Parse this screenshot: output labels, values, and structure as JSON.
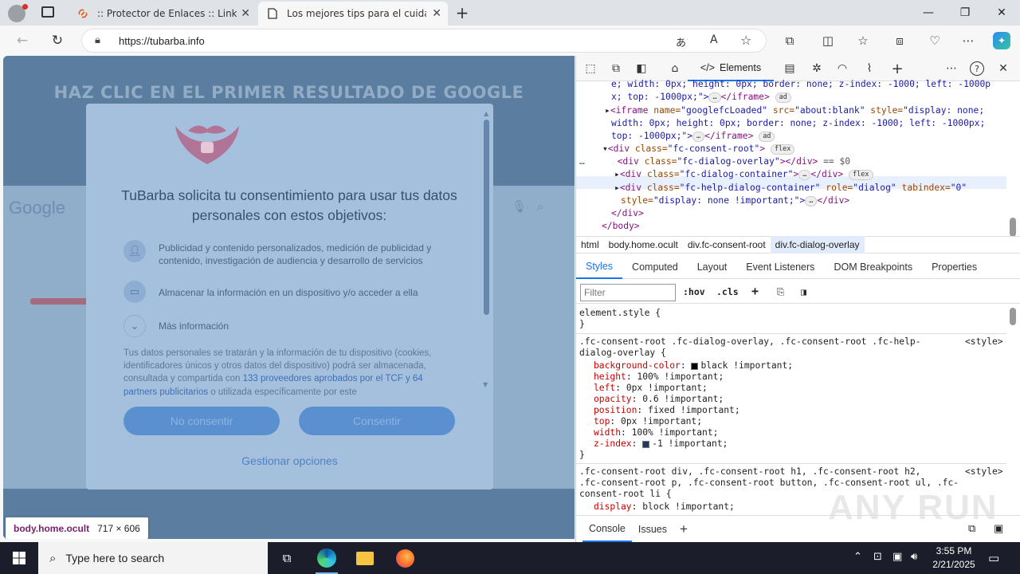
{
  "browser": {
    "tabs": [
      {
        "title": ":: Protector de Enlaces :: Link Prot",
        "active": false
      },
      {
        "title": "Los mejores tips para el cuidado",
        "active": true
      }
    ],
    "url": "https://tubarba.info"
  },
  "page": {
    "background_heading": "HAZ CLIC EN EL PRIMER RESULTADO DE GOOGLE",
    "google_logo": "Google",
    "consent": {
      "title": "TuBarba solicita tu consentimiento para usar tus datos personales con estos objetivos:",
      "purposes": [
        {
          "icon": "person-icon",
          "text": "Publicidad y contenido personalizados, medición de publicidad y contenido, investigación de audiencia y desarrollo de servicios"
        },
        {
          "icon": "device-icon",
          "text": "Almacenar la información en un dispositivo y/o acceder a ella"
        },
        {
          "icon": "chevron-down-icon",
          "text": "Más información"
        }
      ],
      "info_text_1": "Tus datos personales se tratarán y la información de tu dispositivo (cookies, identificadores únicos y otros datos del dispositivo) podrá ser almacenada, consultada y compartida con ",
      "info_link_1": "133 proveedores aprobados por el TCF y 64 partners publicitarios",
      "info_text_2": " o utilizada específicamente por este",
      "decline_label": "No consentir",
      "accept_label": "Consentir",
      "manage_label": "Gestionar opciones"
    },
    "inspect_tooltip": {
      "selector": "body.home.ocult",
      "size": "717 × 606"
    }
  },
  "devtools": {
    "active_tab": "Elements",
    "breadcrumb": [
      "html",
      "body.home.ocult",
      "div.fc-consent-root",
      "div.fc-dialog-overlay"
    ],
    "style_tabs": [
      "Styles",
      "Computed",
      "Layout",
      "Event Listeners",
      "DOM Breakpoints",
      "Properties"
    ],
    "filter_placeholder": "Filter",
    "filter_tools": [
      ":hov",
      ".cls"
    ],
    "console_tabs": [
      "Console",
      "Issues"
    ],
    "dom_lines": {
      "l1": "e; width: 0px; height: 0px; border: none; z-index: -1000; left: -1000p",
      "l2a": "x; top: -1000px;\">",
      "l2b": "</iframe>",
      "l3_tag": "<iframe",
      "l3_name": " name=",
      "l3_nv": "\"googlefcLoaded\"",
      "l3_src": " src=",
      "l3_sv": "\"about:blank\"",
      "l3_style": " style=",
      "l3_stv": "\"display: none;",
      "l4": "width: 0px; height: 0px; border: none; z-index: -1000; left: -1000px;",
      "l5a": "top: -1000px;\">",
      "l5b": "</iframe>",
      "l6a": "<div",
      "l6b": " class=",
      "l6c": "\"fc-consent-root\"",
      "l6d": ">",
      "l7a": "<div",
      "l7b": " class=",
      "l7c": "\"fc-dialog-overlay\"",
      "l7d": "></div>",
      "l7e": " == $0",
      "l8a": "<div",
      "l8b": " class=",
      "l8c": "\"fc-dialog-container\"",
      "l8d": ">",
      "l8e": "</div>",
      "l9a": "<div",
      "l9b": " class=",
      "l9c": "\"fc-help-dialog-container\"",
      "l9d": " role=",
      "l9e": "\"dialog\"",
      "l9f": " tabindex=",
      "l9g": "\"0\"",
      "l10a": "style=",
      "l10b": "\"display: none !important;\">",
      "l10c": "</div>",
      "l11": "</div>",
      "l12": "</body>",
      "pill_ad": "ad",
      "pill_flex": "flex",
      "ellipsis": "…"
    },
    "styles": {
      "element_style": "element.style {",
      "close": "}",
      "rule1_selector_a": ".fc-consent-root .fc-dialog-overlay, .fc-consent-root .fc-help-",
      "rule1_selector_b": "dialog-overlay {",
      "source": "<style>",
      "rule1_props": [
        {
          "name": "background-color",
          "value": "black !important;",
          "swatch": "#000000"
        },
        {
          "name": "height",
          "value": "100% !important;"
        },
        {
          "name": "left",
          "value": "0px !important;"
        },
        {
          "name": "opacity",
          "value": "0.6 !important;"
        },
        {
          "name": "position",
          "value": "fixed !important;"
        },
        {
          "name": "top",
          "value": "0px !important;"
        },
        {
          "name": "width",
          "value": "100% !important;"
        },
        {
          "name": "z-index",
          "value": "-1 !important;"
        }
      ],
      "rule2_selector_a": ".fc-consent-root div, .fc-consent-root h1, .fc-consent-root h2,",
      "rule2_selector_b": ".fc-consent-root p, .fc-consent-root button, .fc-consent-root ul, .fc-",
      "rule2_selector_c": "consent-root li {",
      "rule2_prop": {
        "name": "display",
        "value": "block !important;"
      }
    }
  },
  "watermark": "ANY RUN",
  "taskbar": {
    "search_placeholder": "Type here to search",
    "time": "3:55 PM",
    "date": "2/21/2025"
  },
  "colors": {
    "accent": "#1a73e8",
    "dialog_button": "#5b90d0",
    "overlay": "#5c7fa2"
  }
}
